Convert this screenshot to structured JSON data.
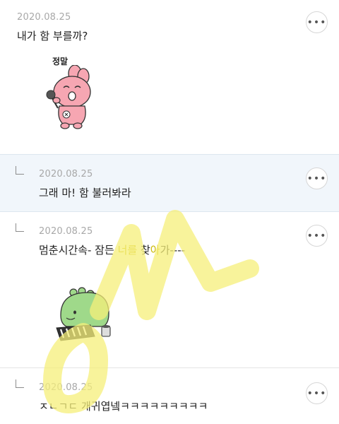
{
  "comments": [
    {
      "date": "2020.08.25",
      "text": "내가 함 부를까?",
      "sticker": {
        "name": "pink-rabbit-singing",
        "caption": "정말"
      },
      "more": "•••"
    },
    {
      "date": "2020.08.25",
      "text": "그래 마! 함 불러봐라",
      "reply": true,
      "more": "•••"
    },
    {
      "date": "2020.08.25",
      "text_before": "멈춘시간속- 잠든 ",
      "text_highlight": "너를",
      "text_mid": " 찾",
      "text_highlight2": "아",
      "text_after": "가----",
      "reply": true,
      "sticker": {
        "name": "green-dino-piano"
      },
      "more": "•••"
    },
    {
      "date": "2020.08.25",
      "text": "ㅈㄴㄱㄷ 개귀엽넼ㅋㅋㅋㅋㅋㅋㅋㅋㅋ",
      "reply": true,
      "more": "•••"
    }
  ],
  "colors": {
    "reply_bg": "#f1f6fb",
    "date": "#a8a8a8",
    "watermark": "#f5ef7a"
  }
}
